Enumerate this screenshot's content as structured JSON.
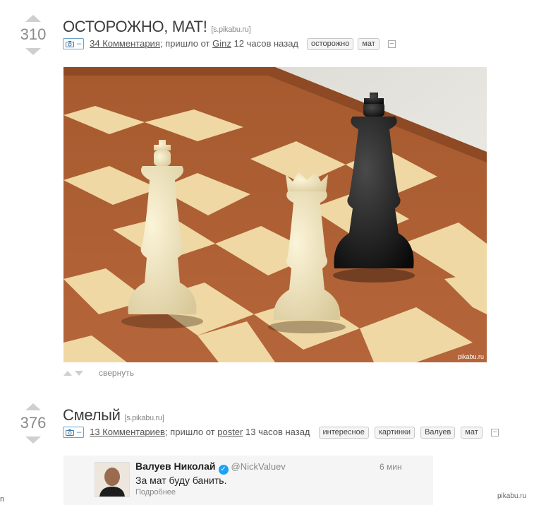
{
  "post1": {
    "score": "310",
    "title": "ОСТОРОЖНО, МАТ!",
    "source": "[s.pikabu.ru]",
    "comments": "34 Комментария",
    "came_from": "; пришло от",
    "author": "Ginz",
    "time": "12 часов назад",
    "tags": [
      "осторожно",
      "мат"
    ],
    "image_watermark": "pikabu.ru",
    "collapse_label": "свернуть"
  },
  "post2": {
    "score": "376",
    "title": "Смелый",
    "source": "[s.pikabu.ru]",
    "comments": "13 Комментариев",
    "came_from": "; пришло от",
    "author": "poster",
    "time": "13 часов назад",
    "tags": [
      "интересное",
      "картинки",
      "Валуев",
      "мат"
    ]
  },
  "tweet": {
    "name": "Валуев Николай",
    "handle": "@NickValuev",
    "time": "6 мин",
    "text": "За мат буду банить.",
    "more": "Подробнее"
  },
  "camera_minus": "–",
  "footer_watermark": "pikabu.ru",
  "edge_char": "n",
  "icons": {
    "vote_up": "triangle-up",
    "vote_down": "triangle-down",
    "camera": "camera-icon",
    "save": "floppy-icon",
    "verified": "verified-icon"
  },
  "colors": {
    "vote_arrow": "#cfcfcf",
    "score": "#8a8a8a",
    "camera_border": "#6aa1c8",
    "verified": "#1da1f2"
  }
}
